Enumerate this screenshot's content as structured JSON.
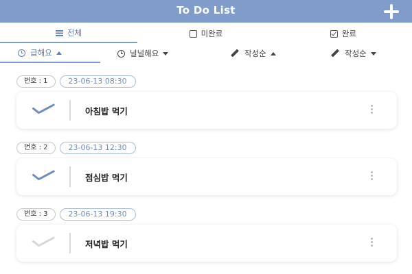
{
  "header": {
    "title": "To Do List",
    "add_icon": "plus-icon"
  },
  "tabs": [
    {
      "label": "전체",
      "icon": "list-icon",
      "active": true
    },
    {
      "label": "미완료",
      "icon": "square-icon",
      "active": false
    },
    {
      "label": "완료",
      "icon": "checkbox-icon",
      "active": false
    }
  ],
  "sorts": [
    {
      "label": "급해요",
      "icon": "clock-icon",
      "direction": "asc",
      "active": true
    },
    {
      "label": "널널해요",
      "icon": "clock-icon",
      "direction": "desc",
      "active": false
    },
    {
      "label": "작성순",
      "icon": "pencil-icon",
      "direction": "asc",
      "active": false
    },
    {
      "label": "작성순",
      "icon": "pencil-icon",
      "direction": "desc",
      "active": false
    }
  ],
  "todos": [
    {
      "number": "번호 : 1",
      "datetime": "23-06-13 08:30",
      "text": "아침밥 먹기",
      "done": true
    },
    {
      "number": "번호 : 2",
      "datetime": "23-06-13 12:30",
      "text": "점심밥 먹기",
      "done": true
    },
    {
      "number": "번호 : 3",
      "datetime": "23-06-13 19:30",
      "text": "저녁밥 먹기",
      "done": false
    }
  ],
  "colors": {
    "accent": "#7f9ccb",
    "accent_text": "#5f80b9",
    "check_done": "#6f8cc0",
    "check_todo": "#d7d7d7"
  }
}
